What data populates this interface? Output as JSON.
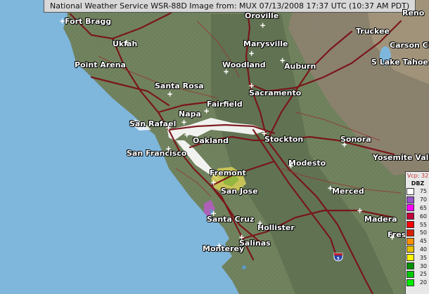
{
  "header": {
    "title": "National Weather Service WSR-88D Image from: MUX 07/13/2008 17:37 UTC (10:37 AM PDT)"
  },
  "cities": [
    {
      "id": "fort-bragg",
      "label": "Fort Bragg"
    },
    {
      "id": "oroville",
      "label": "Oroville"
    },
    {
      "id": "reno",
      "label": "Reno"
    },
    {
      "id": "ukiah",
      "label": "Ukiah"
    },
    {
      "id": "marysville",
      "label": "Marysville"
    },
    {
      "id": "truckee",
      "label": "Truckee"
    },
    {
      "id": "carson-city",
      "label": "Carson City"
    },
    {
      "id": "point-arena",
      "label": "Point Arena"
    },
    {
      "id": "woodland",
      "label": "Woodland"
    },
    {
      "id": "auburn",
      "label": "Auburn"
    },
    {
      "id": "south-lake-tahoe",
      "label": "S Lake Tahoe"
    },
    {
      "id": "santa-rosa",
      "label": "Santa Rosa"
    },
    {
      "id": "sacramento",
      "label": "Sacramento"
    },
    {
      "id": "fairfield",
      "label": "Fairfield"
    },
    {
      "id": "napa",
      "label": "Napa"
    },
    {
      "id": "san-rafael",
      "label": "San Rafael"
    },
    {
      "id": "oakland",
      "label": "Oakland"
    },
    {
      "id": "stockton",
      "label": "Stockton"
    },
    {
      "id": "sonora",
      "label": "Sonora"
    },
    {
      "id": "san-francisco",
      "label": "San Francisco"
    },
    {
      "id": "yosemite-valley",
      "label": "Yosemite Valley"
    },
    {
      "id": "modesto",
      "label": "Modesto"
    },
    {
      "id": "fremont",
      "label": "Fremont"
    },
    {
      "id": "san-jose",
      "label": "San Jose"
    },
    {
      "id": "merced",
      "label": "Merced"
    },
    {
      "id": "santa-cruz",
      "label": "Santa Cruz"
    },
    {
      "id": "madera",
      "label": "Madera"
    },
    {
      "id": "hollister",
      "label": "Hollister"
    },
    {
      "id": "fresno",
      "label": "Fresn"
    },
    {
      "id": "salinas",
      "label": "Salinas"
    },
    {
      "id": "monterey",
      "label": "Monterey"
    }
  ],
  "legend": {
    "vcp": "Vcp: 32",
    "unit": "DBZ",
    "levels": [
      {
        "value": "75",
        "color": "#ffffff"
      },
      {
        "value": "70",
        "color": "#9955c9"
      },
      {
        "value": "65",
        "color": "#ff00ff"
      },
      {
        "value": "60",
        "color": "#c0003a"
      },
      {
        "value": "55",
        "color": "#ff0000"
      },
      {
        "value": "50",
        "color": "#d81e00"
      },
      {
        "value": "45",
        "color": "#ff9000"
      },
      {
        "value": "40",
        "color": "#e8c000"
      },
      {
        "value": "35",
        "color": "#fff500"
      },
      {
        "value": "30",
        "color": "#009000"
      },
      {
        "value": "25",
        "color": "#00c800"
      },
      {
        "value": "20",
        "color": "#00ee00"
      }
    ]
  },
  "highway_shield": {
    "label": "5"
  },
  "colors": {
    "ocean": "#7fb6dc",
    "land": "#6e7f5c",
    "valley": "#5f7050",
    "roads": "#7a1218"
  }
}
